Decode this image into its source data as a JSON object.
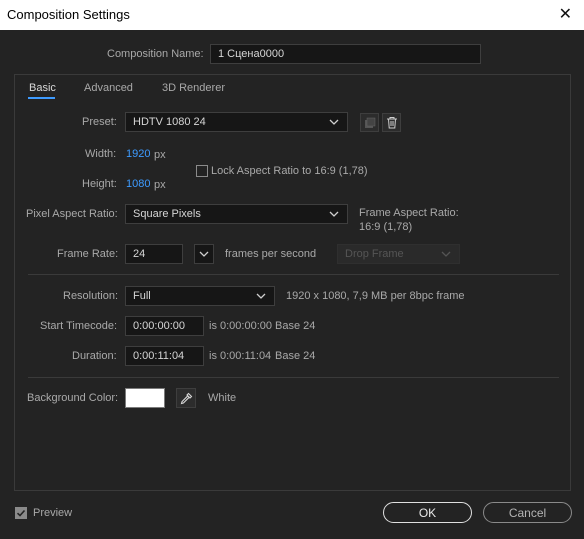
{
  "window": {
    "title": "Composition Settings",
    "close_glyph": "✕"
  },
  "comp_name": {
    "label": "Composition Name:",
    "value": "1 Сцена0000"
  },
  "tabs": [
    {
      "label": "Basic"
    },
    {
      "label": "Advanced"
    },
    {
      "label": "3D Renderer"
    }
  ],
  "preset": {
    "label": "Preset:",
    "value": "HDTV 1080 24"
  },
  "width": {
    "label": "Width:",
    "value": "1920",
    "unit": "px"
  },
  "height": {
    "label": "Height:",
    "value": "1080",
    "unit": "px"
  },
  "lock_aspect": {
    "label": "Lock Aspect Ratio to 16:9 (1,78)",
    "checked": false
  },
  "pixel_aspect": {
    "label": "Pixel Aspect Ratio:",
    "value": "Square Pixels"
  },
  "frame_aspect": {
    "label": "Frame Aspect Ratio:",
    "value": "16:9 (1,78)"
  },
  "frame_rate": {
    "label": "Frame Rate:",
    "value": "24",
    "unit": "frames per second",
    "drop_frame": "Drop Frame"
  },
  "resolution": {
    "label": "Resolution:",
    "value": "Full",
    "info": "1920 x 1080, 7,9 MB per 8bpc frame"
  },
  "start_timecode": {
    "label": "Start Timecode:",
    "value": "0:00:00:00",
    "is": "is 0:00:00:00",
    "base": "Base 24"
  },
  "duration": {
    "label": "Duration:",
    "value": "0:00:11:04",
    "is": "is 0:00:11:04",
    "base": "Base 24"
  },
  "background": {
    "label": "Background Color:",
    "color": "#ffffff",
    "name": "White"
  },
  "preview": {
    "label": "Preview",
    "checked": true
  },
  "buttons": {
    "ok": "OK",
    "cancel": "Cancel"
  },
  "colors": {
    "accent": "#3e9bff",
    "background": "#232323"
  }
}
